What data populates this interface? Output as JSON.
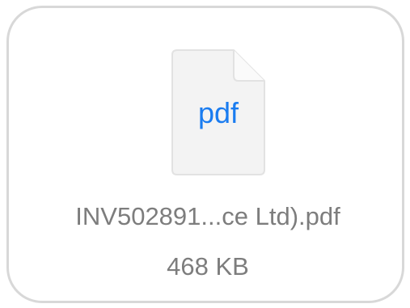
{
  "attachment": {
    "icon": "pdf-document-icon",
    "extension_label": "pdf",
    "file_name": "INV502891...ce Ltd).pdf",
    "file_size": "468 KB"
  },
  "colors": {
    "extension_label": "#1a7cf0",
    "text_secondary": "#7d7d7d",
    "card_border": "#d8d8d8",
    "icon_fill": "#f3f3f3",
    "icon_stroke": "#e2e2e2"
  }
}
